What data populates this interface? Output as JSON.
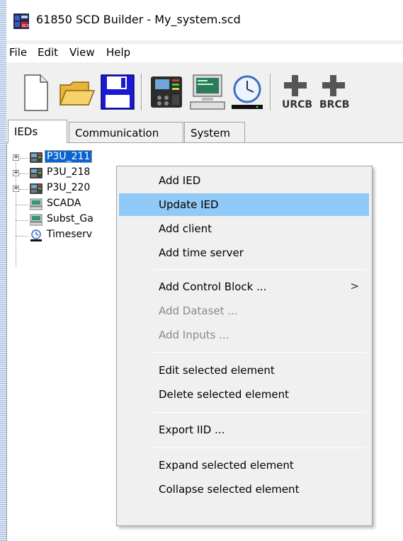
{
  "window": {
    "title": "61850 SCD Builder - My_system.scd"
  },
  "menubar": {
    "items": [
      "File",
      "Edit",
      "View",
      "Help"
    ]
  },
  "toolbar": {
    "buttons": [
      "new-file-icon",
      "open-folder-icon",
      "save-icon",
      "ied-icon",
      "client-computer-icon",
      "time-server-icon",
      "add-urcb-icon",
      "add-brcb-icon"
    ],
    "urcb_label": "URCB",
    "brcb_label": "BRCB"
  },
  "tabs": [
    {
      "label": "IEDs",
      "active": true
    },
    {
      "label": "Communication",
      "active": false
    },
    {
      "label": "System",
      "active": false
    }
  ],
  "tree": {
    "items": [
      {
        "label": "P3U_211",
        "type": "ied",
        "selected": true,
        "expandable": true
      },
      {
        "label": "P3U_218",
        "type": "ied",
        "selected": false,
        "expandable": true
      },
      {
        "label": "P3U_220",
        "type": "ied",
        "selected": false,
        "expandable": true
      },
      {
        "label": "SCADA",
        "type": "client",
        "selected": false,
        "expandable": false
      },
      {
        "label": "Subst_Ga",
        "type": "client",
        "selected": false,
        "expandable": false
      },
      {
        "label": "Timeserv",
        "type": "timeserver",
        "selected": false,
        "expandable": false
      }
    ]
  },
  "context_menu": {
    "items": [
      {
        "label": "Add IED",
        "enabled": true
      },
      {
        "label": "Update IED",
        "enabled": true,
        "highlighted": true
      },
      {
        "label": "Add client",
        "enabled": true
      },
      {
        "label": "Add time server",
        "enabled": true
      },
      {
        "label": "Add Control Block ...",
        "enabled": true,
        "submenu": true
      },
      {
        "label": "Add Dataset ...",
        "enabled": false
      },
      {
        "label": "Add Inputs ...",
        "enabled": false
      },
      {
        "label": "Edit selected element",
        "enabled": true
      },
      {
        "label": "Delete selected element",
        "enabled": true
      },
      {
        "label": "Export IID ...",
        "enabled": true
      },
      {
        "label": "Expand selected element",
        "enabled": true
      },
      {
        "label": "Collapse selected element",
        "enabled": true
      }
    ],
    "submenu_arrow": ">"
  },
  "colors": {
    "selection": "#0a64d2",
    "menu_highlight": "#91c9f7",
    "disabled_text": "#8a8a8a"
  }
}
